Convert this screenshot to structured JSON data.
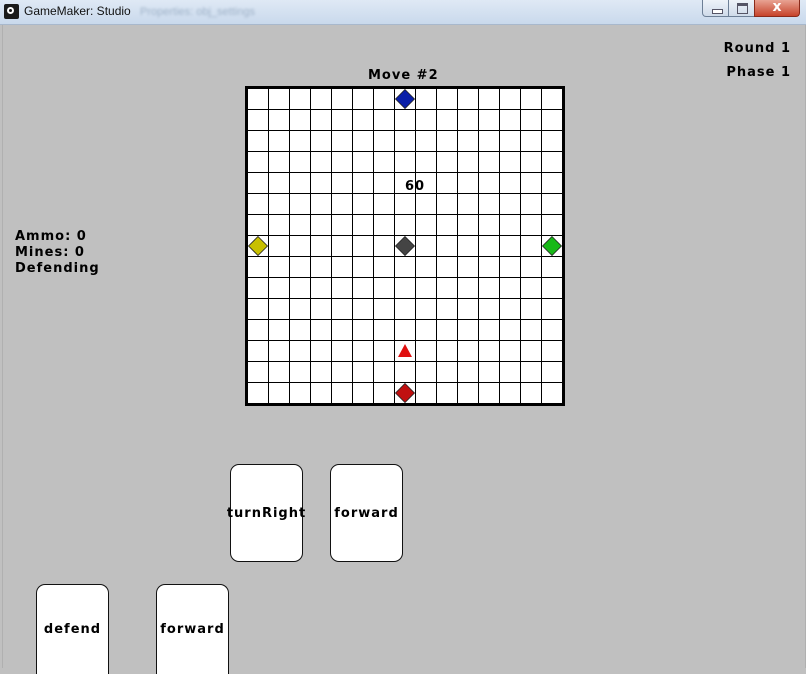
{
  "window": {
    "title": "GameMaker: Studio",
    "blurred_tab": "Properties: obj_settings"
  },
  "hud": {
    "round": "Round 1",
    "phase": "Phase 1",
    "move": "Move #2",
    "ammo": "Ammo: 0",
    "mines": "Mines: 0",
    "status": "Defending"
  },
  "board": {
    "columns": 15,
    "rows": 15,
    "counter": "60",
    "pieces": [
      {
        "name": "blue-diamond",
        "shape": "diamond",
        "color": "#0a1fa8",
        "col": 7,
        "row": 0
      },
      {
        "name": "yellow-diamond",
        "shape": "diamond",
        "color": "#c8c000",
        "col": 0,
        "row": 7
      },
      {
        "name": "dark-diamond",
        "shape": "diamond",
        "color": "#444444",
        "col": 7,
        "row": 7
      },
      {
        "name": "green-diamond",
        "shape": "diamond",
        "color": "#18b818",
        "col": 14,
        "row": 7
      },
      {
        "name": "red-triangle",
        "shape": "triangle",
        "color": "#e01010",
        "col": 7,
        "row": 12
      },
      {
        "name": "red-diamond",
        "shape": "diamond",
        "color": "#c01010",
        "col": 7,
        "row": 14
      }
    ]
  },
  "cards": {
    "upper_left": "turnRight",
    "upper_right": "forward",
    "lower_left": "defend",
    "lower_right": "forward"
  }
}
